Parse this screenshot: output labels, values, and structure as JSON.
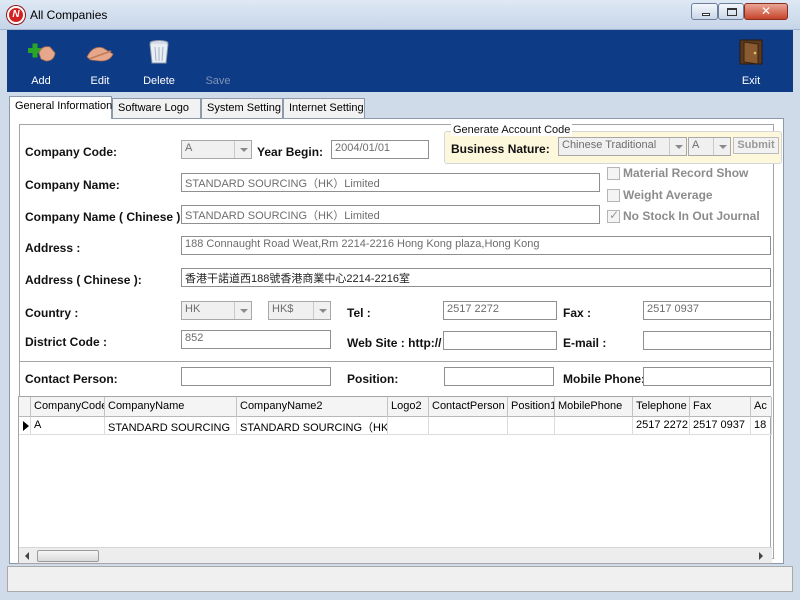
{
  "window": {
    "title": "All Companies",
    "close_glyph": "✕"
  },
  "toolbar": {
    "add": "Add",
    "edit": "Edit",
    "delete": "Delete",
    "save": "Save",
    "exit": "Exit",
    "background_color": "#0e3b86"
  },
  "tabs": [
    "General Information",
    "Software Logo",
    "System Setting",
    "Internet Setting"
  ],
  "form": {
    "company_code_label": "Company Code:",
    "company_code_value": "A",
    "year_begin_label": "Year Begin:",
    "year_begin_value": "2004/01/01",
    "generate_group_title": "Generate Account Code",
    "business_nature_label": "Business Nature:",
    "business_nature_value": "Chinese Traditional",
    "code_letter_value": "A",
    "submit_label": "Submit",
    "company_name_label": "Company Name:",
    "company_name_value": "STANDARD SOURCING（HK）Limited",
    "company_name_cn_label": "Company Name ( Chinese ):",
    "company_name_cn_value": "STANDARD SOURCING（HK）Limited",
    "material_record_label": "Material Record Show",
    "weight_average_label": "Weight Average",
    "no_stock_label": "No Stock In Out Journal",
    "no_stock_checked": true,
    "address_label": "Address :",
    "address_value": "188 Connaught Road Weat,Rm 2214-2216 Hong Kong plaza,Hong Kong",
    "address_cn_label": "Address ( Chinese ):",
    "address_cn_value": "香港干諾道西188號香港商業中心2214-2216室",
    "country_label": "Country :",
    "country_value": "HK",
    "currency_value": "HK$",
    "tel_label": "Tel :",
    "tel_value": "2517 2272",
    "fax_label": "Fax :",
    "fax_value": "2517 0937",
    "district_label": "District Code :",
    "district_value": "852",
    "website_label": "Web Site : http://",
    "website_value": "",
    "email_label": "E-mail :",
    "email_value": "",
    "contact_label": "Contact Person:",
    "contact_value": "",
    "position_label": "Position:",
    "position_value": "",
    "mobile_label": "Mobile Phone:",
    "mobile_value": ""
  },
  "grid": {
    "columns": [
      "CompanyCode",
      "CompanyName",
      "CompanyName2",
      "Logo2",
      "ContactPerson",
      "Position1",
      "MobilePhone",
      "Telephone",
      "Fax",
      "Ac"
    ],
    "row": [
      "A",
      "STANDARD SOURCING（",
      "STANDARD SOURCING（HK",
      "",
      "",
      "",
      "",
      "2517 2272",
      "2517 0937",
      "18"
    ]
  }
}
